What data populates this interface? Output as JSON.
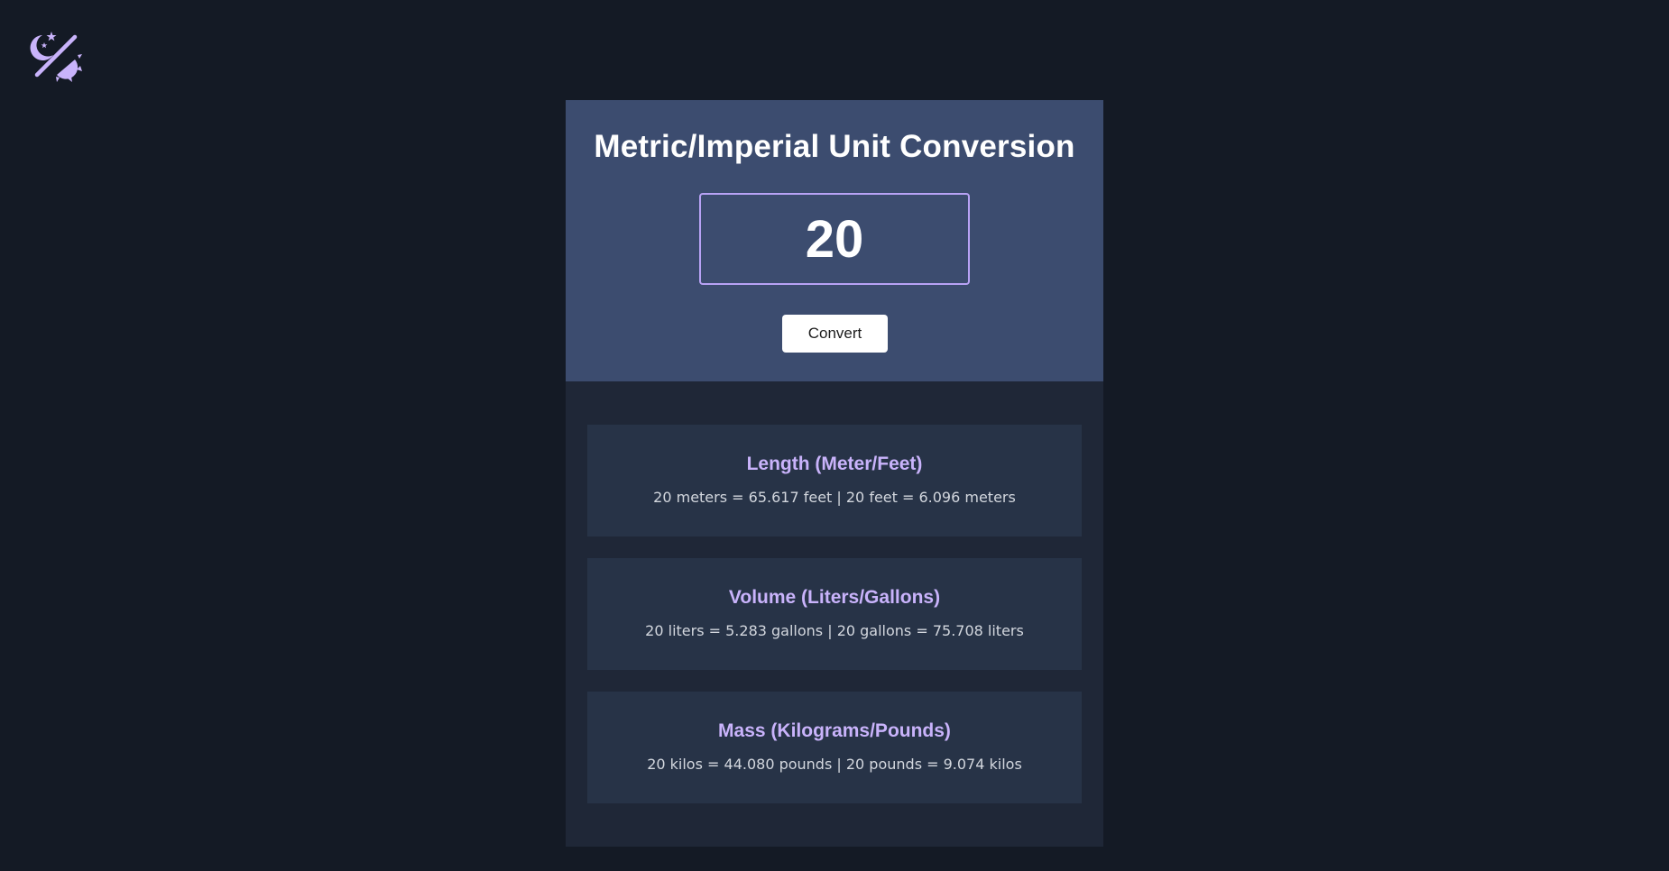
{
  "theme_toggle": {
    "icon": "moon-sun-icon",
    "color": "#c9b3fb"
  },
  "header": {
    "title": "Metric/Imperial Unit Conversion",
    "input_value": "20",
    "convert_label": "Convert"
  },
  "results": [
    {
      "title": "Length (Meter/Feet)",
      "text": "20 meters = 65.617 feet | 20 feet = 6.096 meters"
    },
    {
      "title": "Volume (Liters/Gallons)",
      "text": "20 liters = 5.283 gallons | 20 gallons = 75.708 liters"
    },
    {
      "title": "Mass (Kilograms/Pounds)",
      "text": "20 kilos = 44.080 pounds | 20 pounds = 9.074 kilos"
    }
  ],
  "colors": {
    "page_background": "#141a25",
    "header_background": "#3c4c6f",
    "panel_background": "#1f2737",
    "card_background": "#273347",
    "accent": "#c9b3fb",
    "input_border": "#b8a2f5"
  }
}
